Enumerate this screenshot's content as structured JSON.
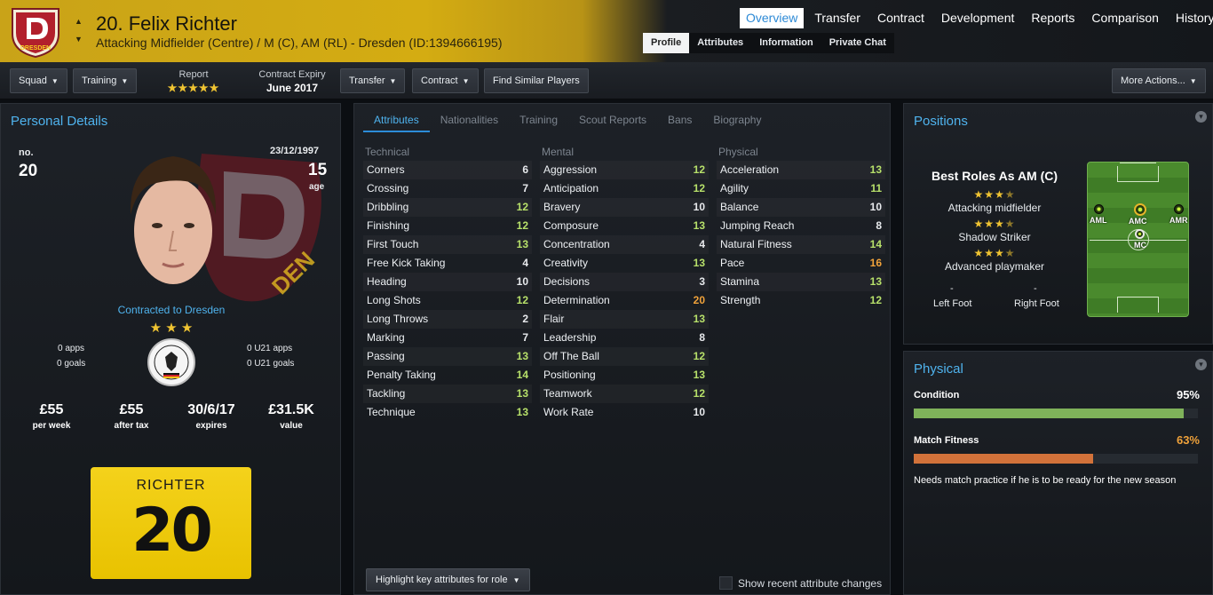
{
  "header": {
    "player_name": "20. Felix Richter",
    "subtitle": "Attacking Midfielder (Centre) / M (C), AM (RL) - Dresden (ID:1394666195)",
    "crest_text": "DRESDEN",
    "nav": [
      "Overview",
      "Transfer",
      "Contract",
      "Development",
      "Reports",
      "Comparison",
      "History"
    ],
    "nav_active": "Overview",
    "subnav": [
      "Profile",
      "Attributes",
      "Information",
      "Private Chat"
    ],
    "subnav_active": "Profile"
  },
  "toolbar": {
    "squad": "Squad",
    "training": "Training",
    "report_label": "Report",
    "report_stars": "★★★★★",
    "contract_label": "Contract Expiry",
    "contract_value": "June 2017",
    "transfer": "Transfer",
    "contract": "Contract",
    "find_similar": "Find Similar Players",
    "more_actions": "More Actions..."
  },
  "personal": {
    "title": "Personal Details",
    "no_label": "no.",
    "number": "20",
    "dob": "23/12/1997",
    "age": "15",
    "age_label": "age",
    "contracted": "Contracted to Dresden",
    "stars": "★ ★ ★",
    "apps": "0 apps",
    "goals": "0 goals",
    "u21_apps": "0 U21 apps",
    "u21_goals": "0 U21 goals",
    "stats": [
      {
        "value": "£55",
        "label": "per week"
      },
      {
        "value": "£55",
        "label": "after tax"
      },
      {
        "value": "30/6/17",
        "label": "expires"
      },
      {
        "value": "£31.5K",
        "label": "value"
      }
    ],
    "shirt_name": "RICHTER",
    "shirt_number": "20"
  },
  "attributes": {
    "tabs": [
      "Attributes",
      "Nationalities",
      "Training",
      "Scout Reports",
      "Bans",
      "Biography"
    ],
    "tab_active": "Attributes",
    "technical_label": "Technical",
    "mental_label": "Mental",
    "physical_label": "Physical",
    "technical": [
      {
        "name": "Corners",
        "value": "6",
        "c": "w"
      },
      {
        "name": "Crossing",
        "value": "7",
        "c": "w"
      },
      {
        "name": "Dribbling",
        "value": "12",
        "c": "g"
      },
      {
        "name": "Finishing",
        "value": "12",
        "c": "g"
      },
      {
        "name": "First Touch",
        "value": "13",
        "c": "g"
      },
      {
        "name": "Free Kick Taking",
        "value": "4",
        "c": "w"
      },
      {
        "name": "Heading",
        "value": "10",
        "c": "w"
      },
      {
        "name": "Long Shots",
        "value": "12",
        "c": "g"
      },
      {
        "name": "Long Throws",
        "value": "2",
        "c": "w"
      },
      {
        "name": "Marking",
        "value": "7",
        "c": "w"
      },
      {
        "name": "Passing",
        "value": "13",
        "c": "g"
      },
      {
        "name": "Penalty Taking",
        "value": "14",
        "c": "g"
      },
      {
        "name": "Tackling",
        "value": "13",
        "c": "g"
      },
      {
        "name": "Technique",
        "value": "13",
        "c": "g"
      }
    ],
    "mental": [
      {
        "name": "Aggression",
        "value": "12",
        "c": "g"
      },
      {
        "name": "Anticipation",
        "value": "12",
        "c": "g"
      },
      {
        "name": "Bravery",
        "value": "10",
        "c": "w"
      },
      {
        "name": "Composure",
        "value": "13",
        "c": "g"
      },
      {
        "name": "Concentration",
        "value": "4",
        "c": "w"
      },
      {
        "name": "Creativity",
        "value": "13",
        "c": "g"
      },
      {
        "name": "Decisions",
        "value": "3",
        "c": "w"
      },
      {
        "name": "Determination",
        "value": "20",
        "c": "o"
      },
      {
        "name": "Flair",
        "value": "13",
        "c": "g"
      },
      {
        "name": "Leadership",
        "value": "8",
        "c": "w"
      },
      {
        "name": "Off The Ball",
        "value": "12",
        "c": "g"
      },
      {
        "name": "Positioning",
        "value": "13",
        "c": "g"
      },
      {
        "name": "Teamwork",
        "value": "12",
        "c": "g"
      },
      {
        "name": "Work Rate",
        "value": "10",
        "c": "w"
      }
    ],
    "physical": [
      {
        "name": "Acceleration",
        "value": "13",
        "c": "g"
      },
      {
        "name": "Agility",
        "value": "11",
        "c": "g"
      },
      {
        "name": "Balance",
        "value": "10",
        "c": "w"
      },
      {
        "name": "Jumping Reach",
        "value": "8",
        "c": "w"
      },
      {
        "name": "Natural Fitness",
        "value": "14",
        "c": "g"
      },
      {
        "name": "Pace",
        "value": "16",
        "c": "o"
      },
      {
        "name": "Stamina",
        "value": "13",
        "c": "g"
      },
      {
        "name": "Strength",
        "value": "12",
        "c": "g"
      }
    ],
    "highlight_button": "Highlight key attributes for role",
    "show_changes": "Show recent attribute changes"
  },
  "positions": {
    "title": "Positions",
    "best_roles_title": "Best Roles As AM (C)",
    "roles": [
      {
        "name": "Attacking midfielder",
        "stars": 3.5
      },
      {
        "name": "Shadow Striker",
        "stars": 3.5
      },
      {
        "name": "Advanced playmaker",
        "stars": 3.5
      }
    ],
    "left_foot_value": "-",
    "left_foot_label": "Left Foot",
    "right_foot_value": "-",
    "right_foot_label": "Right Foot",
    "pitch_labels": [
      "AML",
      "AMC",
      "AMR",
      "MC"
    ]
  },
  "physical": {
    "title": "Physical",
    "condition_label": "Condition",
    "condition_value": "95%",
    "condition_pct": 95,
    "condition_color": "#7fb25a",
    "fitness_label": "Match Fitness",
    "fitness_value": "63%",
    "fitness_pct": 63,
    "fitness_color": "#d2723a",
    "note": "Needs match practice if he is to be ready for the new season"
  }
}
